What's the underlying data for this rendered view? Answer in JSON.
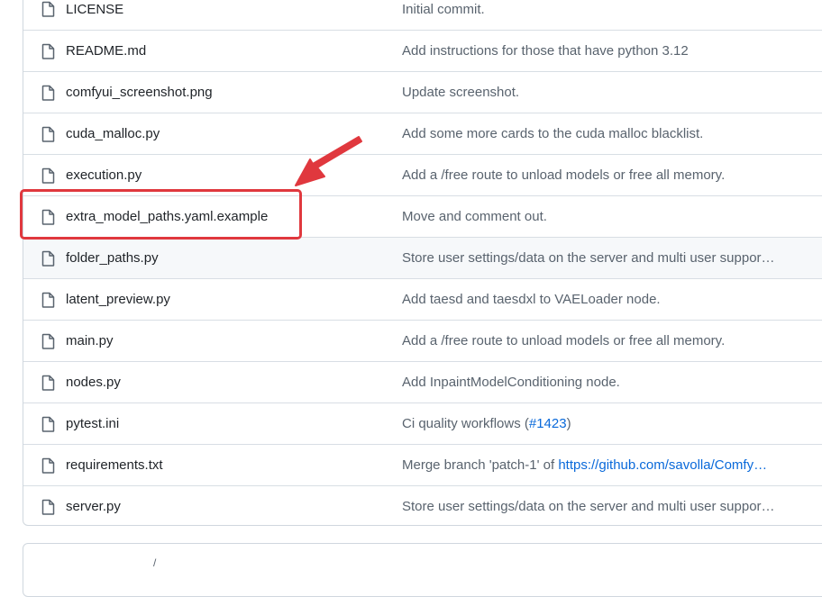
{
  "files": [
    {
      "name": "LICENSE",
      "message": "Initial commit."
    },
    {
      "name": "README.md",
      "message": "Add instructions for those that have python 3.12"
    },
    {
      "name": "comfyui_screenshot.png",
      "message": "Update screenshot."
    },
    {
      "name": "cuda_malloc.py",
      "message": "Add some more cards to the cuda malloc blacklist."
    },
    {
      "name": "execution.py",
      "message": "Add a /free route to unload models or free all memory."
    },
    {
      "name": "extra_model_paths.yaml.example",
      "message": "Move and comment out."
    },
    {
      "name": "folder_paths.py",
      "message": "Store user settings/data on the server and multi user suppor…"
    },
    {
      "name": "latent_preview.py",
      "message": "Add taesd and taesdxl to VAELoader node."
    },
    {
      "name": "main.py",
      "message": "Add a /free route to unload models or free all memory."
    },
    {
      "name": "nodes.py",
      "message": "Add InpaintModelConditioning node."
    },
    {
      "name": "pytest.ini",
      "message_prefix": "Ci quality workflows (",
      "message_link": "#1423",
      "message_suffix": ")"
    },
    {
      "name": "requirements.txt",
      "message_prefix": "Merge branch 'patch-1' of ",
      "message_link": "https://github.com/savolla/Comfy…"
    },
    {
      "name": "server.py",
      "message": "Store user settings/data on the server and multi user suppor…"
    }
  ],
  "bottom_glyph": "/",
  "colors": {
    "annotation": "#e0383e",
    "link": "#0969da",
    "text": "#1f2328",
    "muted": "#59636e",
    "border": "#d0d7de"
  },
  "icons": {
    "file": "file-icon"
  }
}
